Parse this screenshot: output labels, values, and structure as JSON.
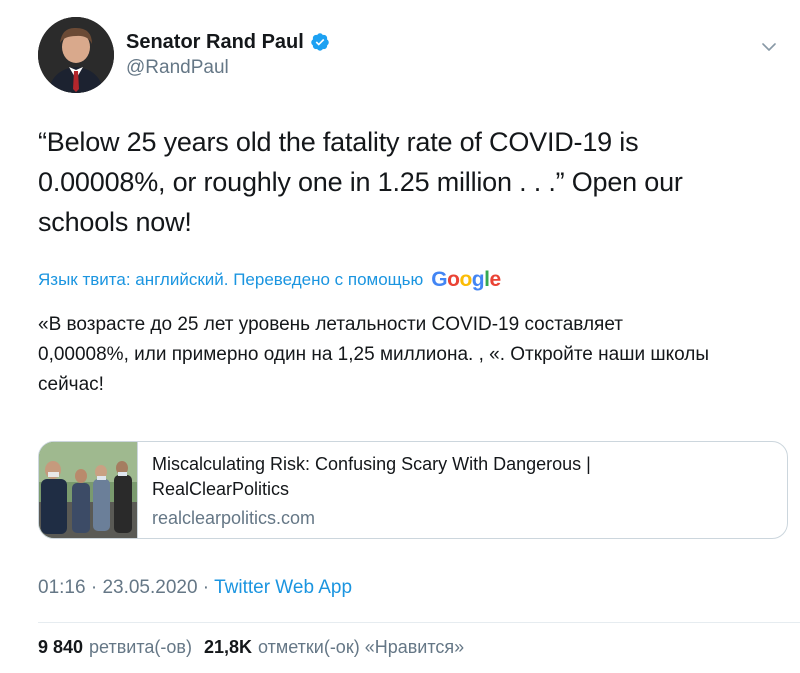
{
  "author": {
    "display_name": "Senator Rand Paul",
    "handle": "@RandPaul",
    "verified_icon": "verified-badge-icon",
    "menu_icon": "chevron-down-icon"
  },
  "tweet": {
    "line1": "“Below 25 years old the fatality rate of COVID-19 is",
    "line2": "0.00008%, or roughly one in 1.25 million . . .”  Open our",
    "line3": "schools now!"
  },
  "translation": {
    "label": "Язык твита: английский. Переведено с помощью",
    "provider": "Google",
    "line1": "«В возрасте до 25 лет уровень летальности COVID-19 составляет",
    "line2": "0,00008%, или примерно один на 1,25 миллиона. , «. Откройте наши школы",
    "line3": "сейчас!"
  },
  "card": {
    "title_line1": "Miscalculating Risk: Confusing Scary With Dangerous |",
    "title_line2": "RealClearPolitics",
    "domain": "realclearpolitics.com"
  },
  "meta": {
    "time": "01:16",
    "separator1": " · ",
    "date": "23.05.2020",
    "separator2": " · ",
    "source": "Twitter Web App"
  },
  "stats": {
    "retweets_count": "9 840",
    "retweets_label": "ретвита(-ов)",
    "likes_count": "21,8K",
    "likes_label": "отметки(-ок) «Нравится»"
  },
  "colors": {
    "link": "#1b95e0",
    "secondary": "#657786",
    "text": "#14171a",
    "border": "#ccd6dd"
  }
}
